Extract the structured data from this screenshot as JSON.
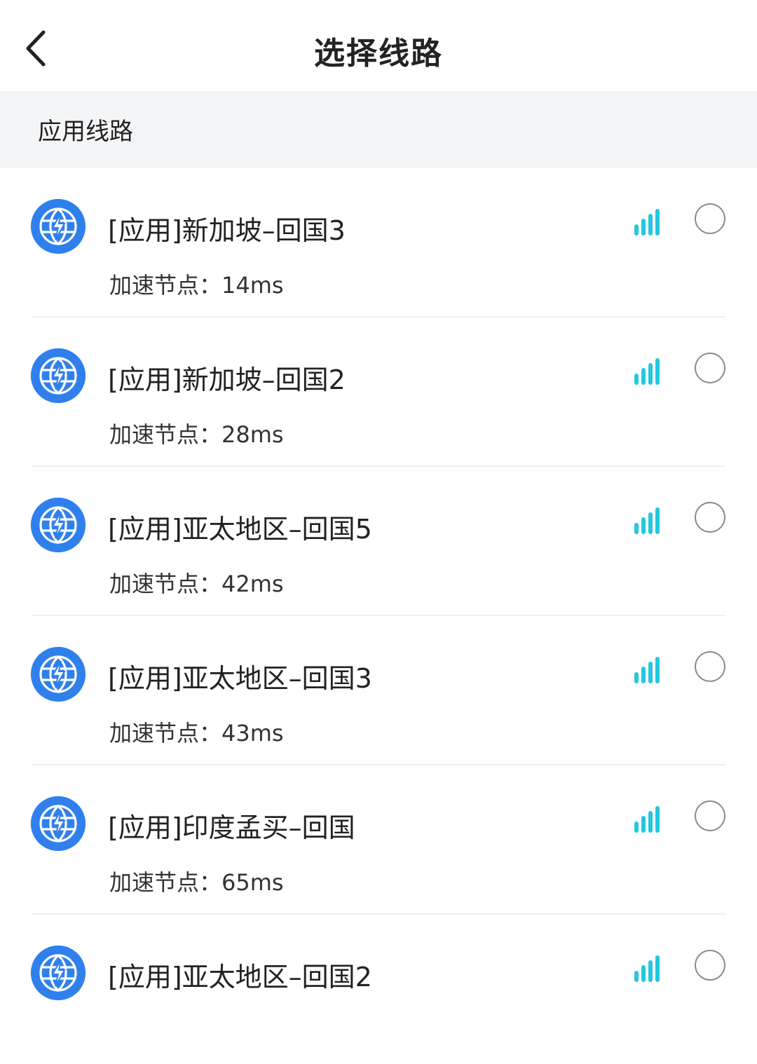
{
  "header": {
    "title": "选择线路",
    "back_icon": "chevron-left-icon"
  },
  "section": {
    "title": "应用线路"
  },
  "colors": {
    "globe": "#2f80ed",
    "signal": "#22c8e0",
    "section_bg": "#f4f5f7"
  },
  "routes": [
    {
      "name": "[应用]新加坡–回国3",
      "latency_label": "加速节点：",
      "latency": "14ms",
      "selected": false
    },
    {
      "name": "[应用]新加坡–回国2",
      "latency_label": "加速节点：",
      "latency": "28ms",
      "selected": false
    },
    {
      "name": "[应用]亚太地区–回国5",
      "latency_label": "加速节点：",
      "latency": "42ms",
      "selected": false
    },
    {
      "name": "[应用]亚太地区–回国3",
      "latency_label": "加速节点：",
      "latency": "43ms",
      "selected": false
    },
    {
      "name": "[应用]印度孟买–回国",
      "latency_label": "加速节点：",
      "latency": "65ms",
      "selected": false
    },
    {
      "name": "[应用]亚太地区–回国2",
      "latency_label": "",
      "latency": "",
      "selected": false
    }
  ]
}
